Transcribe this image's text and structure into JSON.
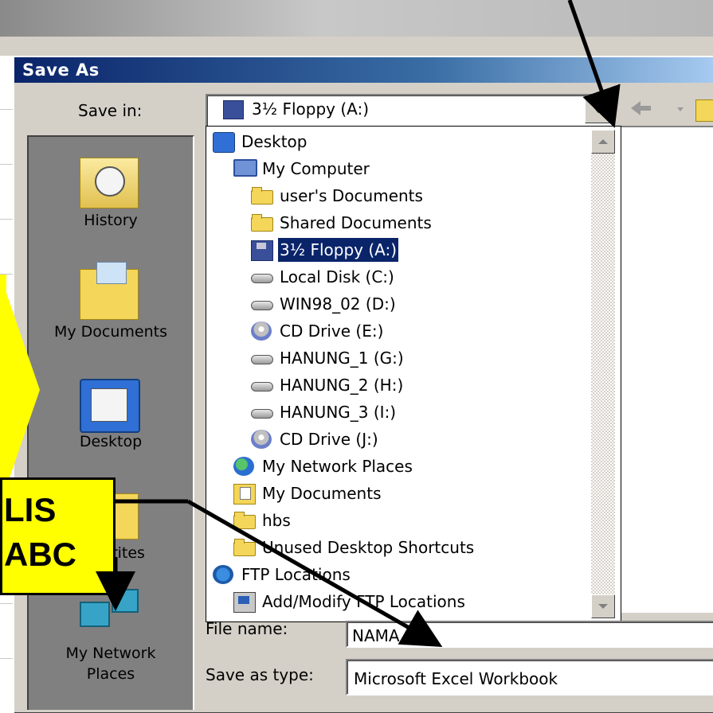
{
  "dialog": {
    "title": "Save As",
    "save_in_label": "Save in:",
    "save_in_value": "3½ Floppy (A:)",
    "file_name_label": "File name:",
    "file_name_value": "NAMA",
    "save_as_type_label": "Save as type:",
    "save_as_type_value": "Microsoft Excel Workbook"
  },
  "places": [
    {
      "label": "History",
      "icon": "history-icon"
    },
    {
      "label": "My Documents",
      "icon": "my-documents-icon"
    },
    {
      "label": "Desktop",
      "icon": "desktop-icon"
    },
    {
      "label": "Favorites",
      "icon": "favorites-icon"
    },
    {
      "label": "My Network Places",
      "label_line1": "My Network",
      "label_line2": "Places",
      "icon": "network-places-icon"
    }
  ],
  "dropdown_items": [
    {
      "label": "Desktop",
      "icon": "desktop-icon"
    },
    {
      "label": "My Computer",
      "icon": "computer-icon"
    },
    {
      "label": "user's Documents",
      "icon": "folder-icon"
    },
    {
      "label": "Shared Documents",
      "icon": "folder-icon"
    },
    {
      "label": "3½ Floppy (A:)",
      "icon": "floppy-icon",
      "selected": true
    },
    {
      "label": "Local Disk (C:)",
      "icon": "hard-disk-icon"
    },
    {
      "label": "WIN98_02 (D:)",
      "icon": "hard-disk-icon"
    },
    {
      "label": "CD Drive (E:)",
      "icon": "cd-drive-icon"
    },
    {
      "label": "HANUNG_1 (G:)",
      "icon": "hard-disk-icon"
    },
    {
      "label": "HANUNG_2 (H:)",
      "icon": "hard-disk-icon"
    },
    {
      "label": "HANUNG_3 (I:)",
      "icon": "hard-disk-icon"
    },
    {
      "label": "CD Drive (J:)",
      "icon": "cd-drive-icon"
    },
    {
      "label": "My Network Places",
      "icon": "network-places-icon"
    },
    {
      "label": "My Documents",
      "icon": "my-documents-icon"
    },
    {
      "label": "hbs",
      "icon": "folder-icon"
    },
    {
      "label": "Unused Desktop Shortcuts",
      "icon": "folder-icon"
    },
    {
      "label": "FTP Locations",
      "icon": "ftp-icon"
    },
    {
      "label": "Add/Modify FTP Locations",
      "icon": "add-ftp-icon"
    }
  ],
  "annotation": {
    "line1": "LIS",
    "line2": "ABC",
    "color": "#ffff00"
  },
  "colors": {
    "title_bar": "#0a246a",
    "dialog_face": "#d4d0c8",
    "selection": "#0a246a"
  }
}
